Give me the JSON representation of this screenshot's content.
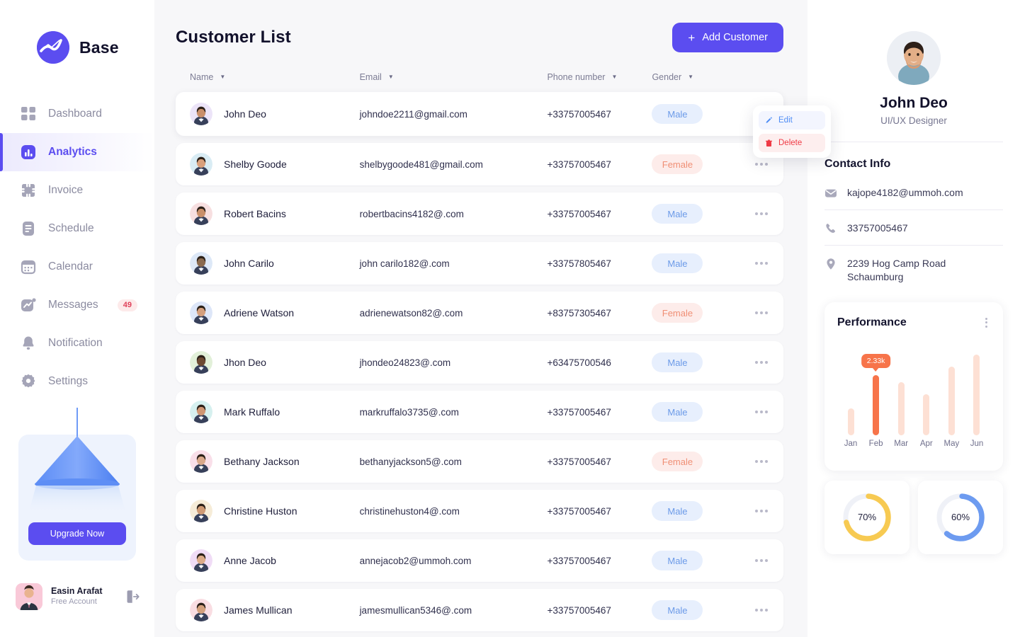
{
  "brand": {
    "name": "Base",
    "logo_icon": "wave-circle-logo"
  },
  "sidebar": {
    "items": [
      {
        "label": "Dashboard",
        "icon": "grid-icon",
        "active": false,
        "badge": ""
      },
      {
        "label": "Analytics",
        "icon": "bar-chart-icon",
        "active": true,
        "badge": ""
      },
      {
        "label": "Invoice",
        "icon": "invoice-icon",
        "active": false,
        "badge": ""
      },
      {
        "label": "Schedule",
        "icon": "schedule-icon",
        "active": false,
        "badge": ""
      },
      {
        "label": "Calendar",
        "icon": "calendar-icon",
        "active": false,
        "badge": ""
      },
      {
        "label": "Messages",
        "icon": "messages-icon",
        "active": false,
        "badge": "49"
      },
      {
        "label": "Notification",
        "icon": "bell-icon",
        "active": false,
        "badge": ""
      },
      {
        "label": "Settings",
        "icon": "gear-icon",
        "active": false,
        "badge": ""
      }
    ],
    "upgrade": {
      "button_label": "Upgrade Now",
      "illustration": "lamp-illustration"
    },
    "user": {
      "name": "Easin Arafat",
      "plan": "Free Account",
      "logout_icon": "logout-icon"
    }
  },
  "main": {
    "title": "Customer List",
    "add_button": {
      "label": "Add Customer",
      "icon": "plus-icon"
    },
    "columns": [
      {
        "label": "Name",
        "sort_icon": "caret-down-icon"
      },
      {
        "label": "Email",
        "sort_icon": "caret-down-icon"
      },
      {
        "label": "Phone number",
        "sort_icon": "caret-down-icon"
      },
      {
        "label": "Gender",
        "sort_icon": "caret-down-icon"
      }
    ],
    "rows": [
      {
        "name": "John Deo",
        "email": "johndoe2211@gmail.com",
        "phone": "+33757005467",
        "gender": "Male",
        "selected": true,
        "avatar_tone": "#ece4f8"
      },
      {
        "name": "Shelby Goode",
        "email": "shelbygoode481@gmail.com",
        "phone": "+33757005467",
        "gender": "Female",
        "selected": false,
        "avatar_tone": "#d9ecf4"
      },
      {
        "name": "Robert Bacins",
        "email": "robertbacins4182@.com",
        "phone": "+33757005467",
        "gender": "Male",
        "selected": false,
        "avatar_tone": "#f7dfe0"
      },
      {
        "name": "John Carilo",
        "email": "john carilo182@.com",
        "phone": "+33757805467",
        "gender": "Male",
        "selected": false,
        "avatar_tone": "#dde8f7"
      },
      {
        "name": "Adriene Watson",
        "email": "adrienewatson82@.com",
        "phone": "+83757305467",
        "gender": "Female",
        "selected": false,
        "avatar_tone": "#dde6f8"
      },
      {
        "name": "Jhon Deo",
        "email": "jhondeo24823@.com",
        "phone": "+63475700546",
        "gender": "Male",
        "selected": false,
        "avatar_tone": "#e2f0d9"
      },
      {
        "name": "Mark Ruffalo",
        "email": "markruffalo3735@.com",
        "phone": "+33757005467",
        "gender": "Male",
        "selected": false,
        "avatar_tone": "#d6f0ef"
      },
      {
        "name": "Bethany Jackson",
        "email": "bethanyjackson5@.com",
        "phone": "+33757005467",
        "gender": "Female",
        "selected": false,
        "avatar_tone": "#f9dfe9"
      },
      {
        "name": "Christine Huston",
        "email": "christinehuston4@.com",
        "phone": "+33757005467",
        "gender": "Male",
        "selected": false,
        "avatar_tone": "#f6ecd8"
      },
      {
        "name": "Anne Jacob",
        "email": "annejacob2@ummoh.com",
        "phone": "+33757005467",
        "gender": "Male",
        "selected": false,
        "avatar_tone": "#f0dcf6"
      },
      {
        "name": "James Mullican",
        "email": "jamesmullican5346@.com",
        "phone": "+33757005467",
        "gender": "Male",
        "selected": false,
        "avatar_tone": "#f9dde2"
      }
    ],
    "context_menu": {
      "edit": {
        "label": "Edit",
        "icon": "pencil-icon"
      },
      "delete": {
        "label": "Delete",
        "icon": "trash-icon"
      }
    }
  },
  "right": {
    "profile": {
      "name": "John Deo",
      "role": "UI/UX Designer",
      "avatar": "user-photo"
    },
    "contact": {
      "title": "Contact Info",
      "items": [
        {
          "icon": "mail-icon",
          "value": "kajope4182@ummoh.com"
        },
        {
          "icon": "phone-icon",
          "value": "33757005467"
        },
        {
          "icon": "pin-icon",
          "value": "2239  Hog Camp Road Schaumburg"
        }
      ]
    },
    "performance": {
      "title": "Performance",
      "menu_icon": "vertical-dots-icon"
    },
    "donuts": [
      {
        "label": "70%",
        "value": 70,
        "color": "#f7ca52",
        "track": "#eff1f7"
      },
      {
        "label": "60%",
        "value": 60,
        "color": "#6d9bf0",
        "track": "#eff1f7"
      }
    ]
  },
  "chart_data": {
    "type": "bar",
    "title": "Performance",
    "categories": [
      "Jan",
      "Feb",
      "Mar",
      "Apr",
      "May",
      "Jun"
    ],
    "values": [
      0.95,
      2.33,
      2.05,
      1.55,
      2.7,
      3.2
    ],
    "unit": "k",
    "highlight_index": 1,
    "highlight_label": "2.33k",
    "bar_color": "#fde0d4",
    "highlight_color": "#f7744a",
    "xlabel": "",
    "ylabel": "",
    "grid": false,
    "legend": "none"
  },
  "colors": {
    "accent": "#5b4df0",
    "male_badge_bg": "#e7effd",
    "male_badge_fg": "#6b9ae8",
    "female_badge_bg": "#fdecea",
    "female_badge_fg": "#f08f75",
    "danger": "#ef3a45",
    "edit": "#4f8df5",
    "page_bg": "#f7f7f9"
  }
}
